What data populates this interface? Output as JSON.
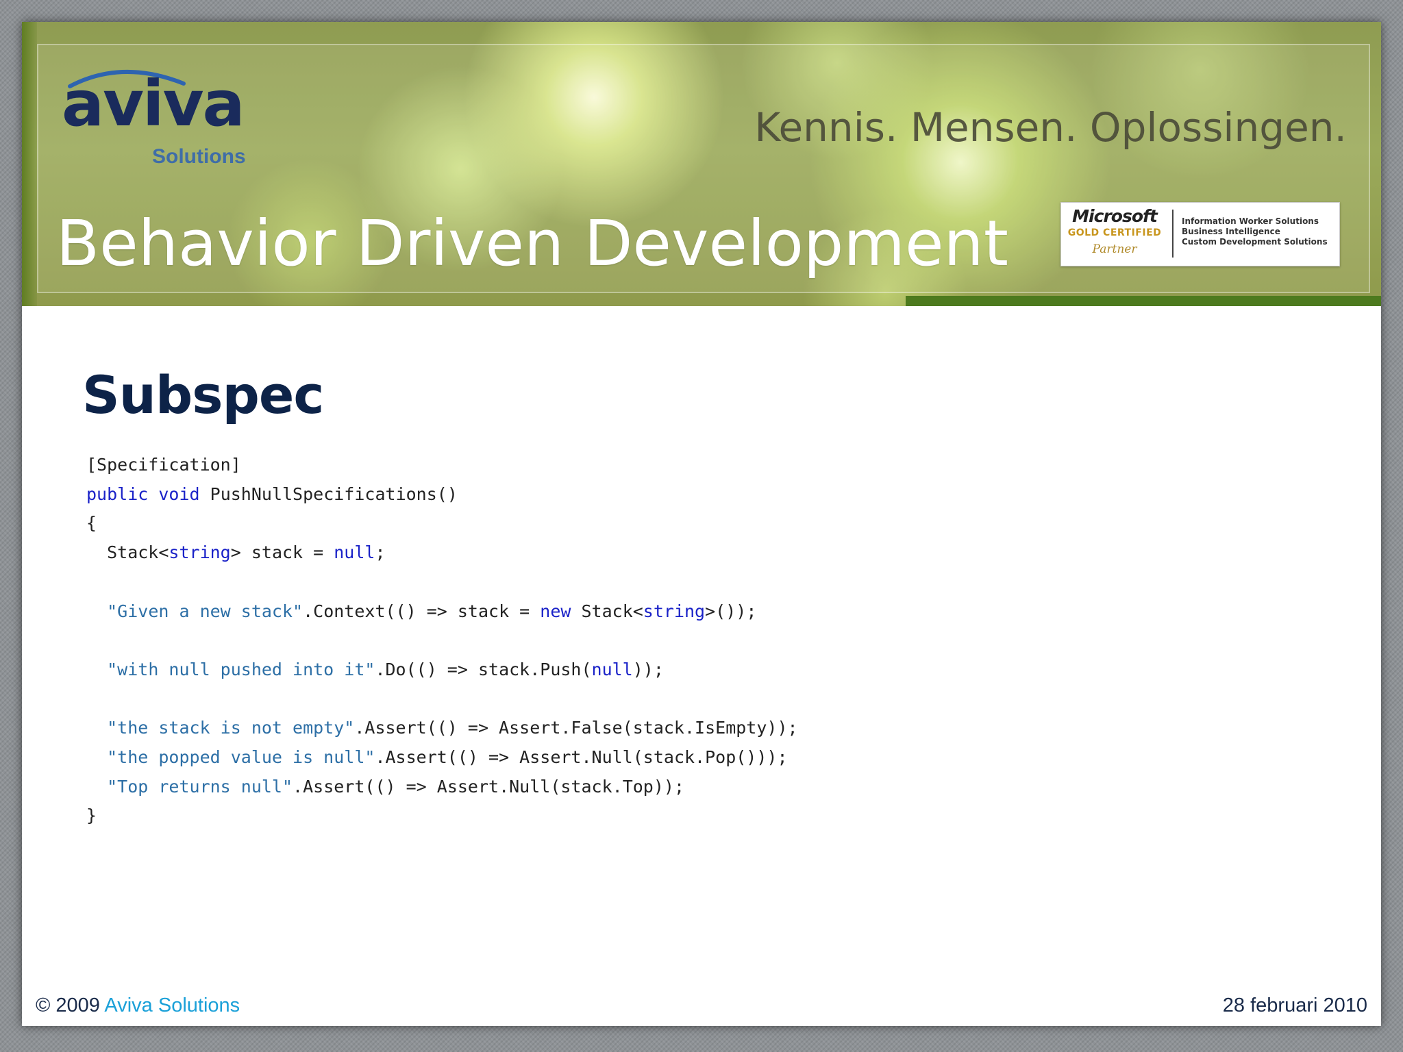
{
  "header": {
    "logo_word": "aviva",
    "logo_sub": "Solutions",
    "tagline": "Kennis. Mensen. Oplossingen.",
    "title": "Behavior Driven Development",
    "badge": {
      "brand": "Microsoft",
      "certified": "GOLD CERTIFIED",
      "partner": "Partner",
      "competencies": [
        "Information Worker Solutions",
        "Business Intelligence",
        "Custom Development Solutions"
      ]
    }
  },
  "slide": {
    "title": "Subspec",
    "code_lines": [
      [
        {
          "t": "[Specification]",
          "c": "plain"
        }
      ],
      [
        {
          "t": "public",
          "c": "kw"
        },
        {
          "t": " ",
          "c": "plain"
        },
        {
          "t": "void",
          "c": "kw"
        },
        {
          "t": " PushNullSpecifications()",
          "c": "plain"
        }
      ],
      [
        {
          "t": "{",
          "c": "plain"
        }
      ],
      [
        {
          "t": "  Stack<",
          "c": "plain"
        },
        {
          "t": "string",
          "c": "kw"
        },
        {
          "t": "> stack = ",
          "c": "plain"
        },
        {
          "t": "null",
          "c": "kw"
        },
        {
          "t": ";",
          "c": "plain"
        }
      ],
      [],
      [
        {
          "t": "  ",
          "c": "plain"
        },
        {
          "t": "\"Given a new stack\"",
          "c": "str"
        },
        {
          "t": ".Context(() => stack = ",
          "c": "plain"
        },
        {
          "t": "new",
          "c": "kw"
        },
        {
          "t": " Stack<",
          "c": "plain"
        },
        {
          "t": "string",
          "c": "kw"
        },
        {
          "t": ">());",
          "c": "plain"
        }
      ],
      [],
      [
        {
          "t": "  ",
          "c": "plain"
        },
        {
          "t": "\"with null pushed into it\"",
          "c": "str"
        },
        {
          "t": ".Do(() => stack.Push(",
          "c": "plain"
        },
        {
          "t": "null",
          "c": "kw"
        },
        {
          "t": "));",
          "c": "plain"
        }
      ],
      [],
      [
        {
          "t": "  ",
          "c": "plain"
        },
        {
          "t": "\"the stack is not empty\"",
          "c": "str"
        },
        {
          "t": ".Assert(() => Assert.False(stack.IsEmpty));",
          "c": "plain"
        }
      ],
      [
        {
          "t": "  ",
          "c": "plain"
        },
        {
          "t": "\"the popped value is null\"",
          "c": "str"
        },
        {
          "t": ".Assert(() => Assert.Null(stack.Pop()));",
          "c": "plain"
        }
      ],
      [
        {
          "t": "  ",
          "c": "plain"
        },
        {
          "t": "\"Top returns null\"",
          "c": "str"
        },
        {
          "t": ".Assert(() => Assert.Null(stack.Top));",
          "c": "plain"
        }
      ],
      [
        {
          "t": "}",
          "c": "plain"
        }
      ]
    ]
  },
  "footer": {
    "copyright_prefix": "© 2009 ",
    "copyright_brand": "Aviva Solutions",
    "date": "28 februari 2010"
  },
  "colors": {
    "keyword": "#1a22c8",
    "string": "#2d6fa6",
    "title": "#0d2348",
    "footer_brand": "#1aa0d8"
  }
}
